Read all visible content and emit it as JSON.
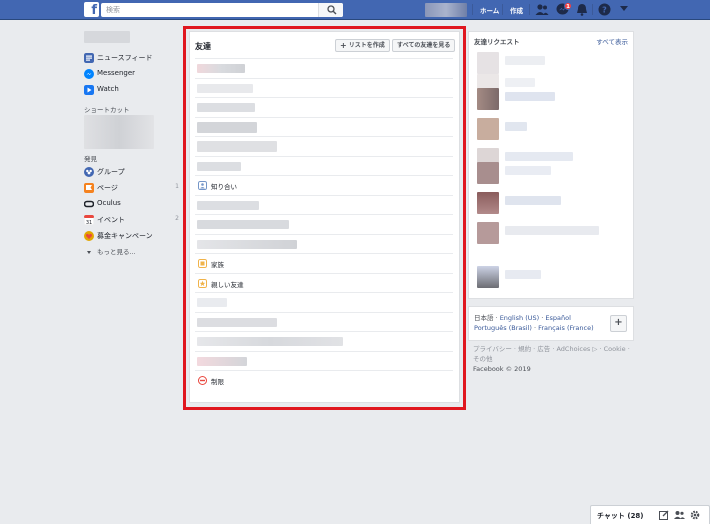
{
  "topbar": {
    "logo": "f",
    "search_placeholder": "検索",
    "nav": {
      "home": "ホーム",
      "create": "作成"
    },
    "message_badge": "1"
  },
  "sidebar": {
    "items": [
      {
        "label": "ニュースフィード",
        "icon": "news-feed-icon",
        "color": "#4267b2"
      },
      {
        "label": "Messenger",
        "icon": "messenger-icon",
        "color": "#0084ff"
      },
      {
        "label": "Watch",
        "icon": "watch-icon",
        "color": "#1877f2"
      }
    ],
    "shortcuts_heading": "ショートカット",
    "explore_heading": "発見",
    "explore": [
      {
        "label": "グループ",
        "icon": "groups-icon",
        "count": "",
        "color": "#4267b2"
      },
      {
        "label": "ページ",
        "icon": "pages-icon",
        "count": "1",
        "color": "#f5821f"
      },
      {
        "label": "Oculus",
        "icon": "oculus-icon",
        "count": "",
        "color": "#1d2129"
      },
      {
        "label": "イベント",
        "icon": "events-icon",
        "count": "2",
        "color": "#e9473e"
      },
      {
        "label": "募金キャンペーン",
        "icon": "fundraiser-icon",
        "count": "",
        "color": "#e2a600"
      }
    ],
    "more": "もっと見る..."
  },
  "friends": {
    "title": "友達",
    "create_list": "リストを作成",
    "see_all": "すべての友達を見る",
    "lists": {
      "acquaintances": "知り合い",
      "family": "家族",
      "close_friends": "親しい友達",
      "restricted": "制限"
    }
  },
  "requests": {
    "title": "友達リクエスト",
    "see_all": "すべて表示"
  },
  "languages": {
    "current": "日本語",
    "options": [
      "English (US)",
      "Español",
      "Português (Brasil)",
      "Français (France)"
    ]
  },
  "footer": {
    "links": "プライバシー · 規約 · 広告 · AdChoices ▷ · Cookie · その他",
    "copyright": "Facebook © 2019"
  },
  "chat": {
    "label": "チャット (28)"
  }
}
